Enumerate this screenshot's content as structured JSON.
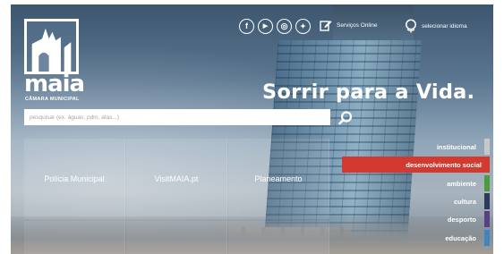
{
  "brand": {
    "name": "maia",
    "subtitle": "CÂMARA MUNICIPAL"
  },
  "topbar": {
    "social": [
      {
        "icon": "facebook-icon",
        "glyph": "f"
      },
      {
        "icon": "youtube-icon",
        "glyph": "▶"
      },
      {
        "icon": "instagram-icon",
        "glyph": "◎"
      },
      {
        "icon": "twitter-icon",
        "glyph": "✦"
      }
    ],
    "online_services_label": "Serviços Online",
    "language_label": "selecionar idioma"
  },
  "hero": {
    "tagline": "Sorrir para a Vida."
  },
  "search": {
    "placeholder": "pesquisar (ex. águas, pdm, atas...)",
    "value": ""
  },
  "tiles": [
    {
      "label": "Polícia Municipal"
    },
    {
      "label": "VisitMAIA.pt"
    },
    {
      "label": "Planeamento"
    }
  ],
  "categories": [
    {
      "label": "institucional",
      "color": "#ffffff00",
      "bar_color": "#c8c8c8",
      "active": false
    },
    {
      "label": "desenvolvimento social",
      "color": "#d23a2f",
      "bar_color": "#d23a2f",
      "active": true
    },
    {
      "label": "ambiente",
      "color": "#ffffff00",
      "bar_color": "#4e9a3e",
      "active": false
    },
    {
      "label": "cultura",
      "color": "#ffffff00",
      "bar_color": "#2e3a5c",
      "active": false
    },
    {
      "label": "desporto",
      "color": "#ffffff00",
      "bar_color": "#5b3f86",
      "active": false
    },
    {
      "label": "educação",
      "color": "#ffffff00",
      "bar_color": "#3d86c6",
      "active": false
    }
  ],
  "colors": {
    "active_category": "#d23a2f",
    "search_bg": "#ffffff",
    "text_light": "#ffffff"
  }
}
